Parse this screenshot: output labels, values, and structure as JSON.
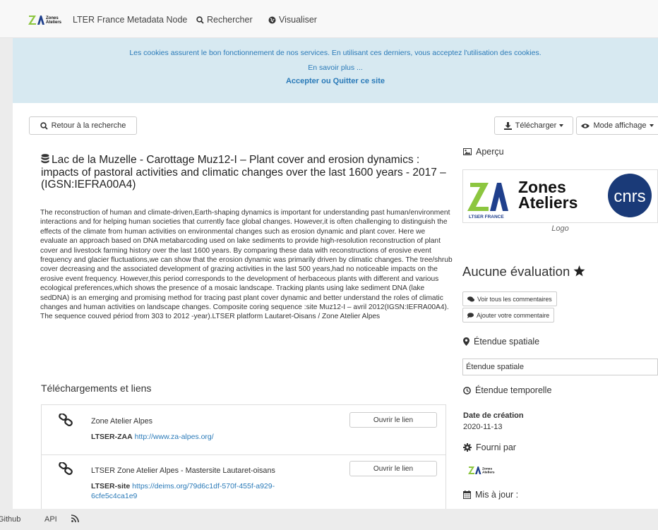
{
  "nav": {
    "logo_alt": "Zones Ateliers",
    "site_name": "LTER France Metadata Node",
    "search": "Rechercher",
    "visualize": "Visualiser"
  },
  "cookie": {
    "message": "Les cookies assurent le bon fonctionnement de nos services. En utilisant ces derniers, vous acceptez l'utilisation des cookies.",
    "more": "En savoir plus ...",
    "accept": "Accepter",
    "or": "ou",
    "quit": "Quitter ce site"
  },
  "toolbar": {
    "back": "Retour à la recherche",
    "download": "Télécharger",
    "display_mode": "Mode affichage"
  },
  "record": {
    "title": "Lac de la Muzelle - Carottage Muz12-I – Plant cover and erosion dynamics : impacts of pastoral activities and climatic changes over the last 1600 years - 2017 – (IGSN:IEFRA00A4)",
    "abstract": "The reconstruction of human and climate-driven,Earth-shaping dynamics is important for understanding past human/environment interactions and for helping human societies that currently face global changes. However,it is often challenging to distinguish the effects of the climate from human activities on environmental changes such as erosion dynamic and plant cover. Here we evaluate an approach based on DNA metabarcoding used on lake sediments to provide high-resolution reconstruction of plant cover and livestock farming history over the last 1600 years. By comparing these data with reconstructions of erosive event frequency and glacier fluctuations,we can show that the erosion dynamic was primarily driven by climatic changes. The tree/shrub cover decreasing and the associated development of grazing activities in the last 500 years,had no noticeable impacts on the erosive event frequency. However,this period corresponds to the development of herbaceous plants with different and various ecological preferences,which shows the presence of a mosaic landscape. Tracking plants using lake sediment DNA (lake sedDNA) is an emerging and promising method for tracing past plant cover dynamic and better understand the roles of climatic changes and human activities on landscape changes. Composite coring sequence :site Muz12-I – avril 2012(IGSN:IEFRA00A4). The sequence couved périod from 303 to 2012 -year).LTSER platform Lautaret-Oisans / Zone Atelier Alpes"
  },
  "links": {
    "heading": "Téléchargements et liens",
    "items": [
      {
        "name": "Zone Atelier Alpes",
        "label": "LTSER-ZAA",
        "url": "http://www.za-alpes.org/",
        "button": "Ouvrir le lien"
      },
      {
        "name": "LTSER Zone Atelier Alpes - Mastersite Lautaret-oisans",
        "label": "LTSER-site",
        "url": "https://deims.org/79d6c1df-570f-455f-a929-6cfe5c4ca1e9",
        "button": "Ouvrir le lien"
      }
    ]
  },
  "sidebar": {
    "preview": "Aperçu",
    "logo_text_1": "Zones",
    "logo_text_2": "Ateliers",
    "logo_sub": "LTSER FRANCE",
    "cnrs": "cnrs",
    "logo_caption": "Logo",
    "rating": "Aucune évaluation",
    "see_comments": "Voir tous les commentaires",
    "add_comment": "Ajouter votre commentaire",
    "spatial": "Étendue spatiale",
    "spatial_value": "Étendue spatiale",
    "temporal": "Étendue temporelle",
    "created_label": "Date de création",
    "created_value": "2020-11-13",
    "provided": "Fourni par",
    "updated": "Mis à jour :"
  },
  "footer": {
    "github": "Github",
    "api": "API"
  },
  "colors": {
    "link": "#2a7ab8",
    "cookie_bg": "#d7e9f1",
    "za_green": "#8cc63f",
    "za_blue": "#1f3f8c",
    "cnrs": "#1a3a78"
  }
}
